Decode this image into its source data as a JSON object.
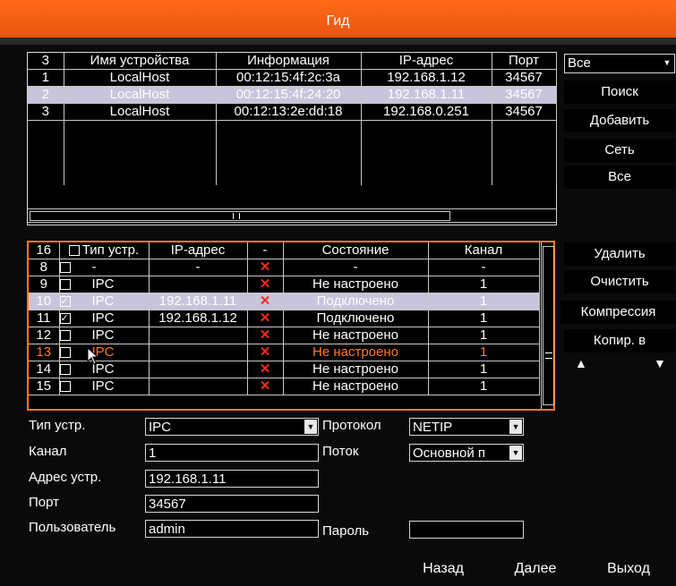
{
  "window": {
    "title": "Гид"
  },
  "search_table": {
    "headers": [
      "3",
      "Имя устройства",
      "Информация",
      "IP-адрес",
      "Порт"
    ],
    "rows": [
      {
        "num": "1",
        "name": "LocalHost",
        "info": "00:12:15:4f:2c:3a",
        "ip": "192.168.1.12",
        "port": "34567",
        "selected": false
      },
      {
        "num": "2",
        "name": "LocalHost",
        "info": "00:12:15:4f:24:20",
        "ip": "192.168.1.11",
        "port": "34567",
        "selected": true
      },
      {
        "num": "3",
        "name": "LocalHost",
        "info": "00:12:13:2e:dd:18",
        "ip": "192.168.0.251",
        "port": "34567",
        "selected": false
      }
    ]
  },
  "filter_select": {
    "value": "Все"
  },
  "right_buttons": {
    "search": "Поиск",
    "add": "Добавить",
    "network": "Сеть",
    "all": "Все"
  },
  "channel_table": {
    "headers": [
      "16",
      "Тип устр.",
      "IP-адрес",
      "-",
      "Состояние",
      "Канал"
    ],
    "rows": [
      {
        "num": "8",
        "checked": false,
        "type": "-",
        "ip": "-",
        "status": "-",
        "channel": "-",
        "style": ""
      },
      {
        "num": "9",
        "checked": false,
        "type": "IPC",
        "ip": "",
        "status": "Не настроено",
        "channel": "1",
        "style": ""
      },
      {
        "num": "10",
        "checked": true,
        "type": "IPC",
        "ip": "192.168.1.11",
        "status": "Подключено",
        "channel": "1",
        "style": "sel"
      },
      {
        "num": "11",
        "checked": true,
        "type": "IPC",
        "ip": "192.168.1.12",
        "status": "Подключено",
        "channel": "1",
        "style": ""
      },
      {
        "num": "12",
        "checked": false,
        "type": "IPC",
        "ip": "",
        "status": "Не настроено",
        "channel": "1",
        "style": ""
      },
      {
        "num": "13",
        "checked": false,
        "type": "IPC",
        "ip": "",
        "status": "Не настроено",
        "channel": "1",
        "style": "orange"
      },
      {
        "num": "14",
        "checked": false,
        "type": "IPC",
        "ip": "",
        "status": "Не настроено",
        "channel": "1",
        "style": ""
      },
      {
        "num": "15",
        "checked": false,
        "type": "IPC",
        "ip": "",
        "status": "Не настроено",
        "channel": "1",
        "style": ""
      }
    ]
  },
  "side_buttons": {
    "delete": "Удалить",
    "clear": "Очистить",
    "compression": "Компрессия",
    "copy_to": "Копир. в"
  },
  "form": {
    "device_type_label": "Тип устр.",
    "device_type_value": "IPC",
    "protocol_label": "Протокол",
    "protocol_value": "NETIP",
    "channel_label": "Канал",
    "channel_value": "1",
    "stream_label": "Поток",
    "stream_value": "Основной п",
    "address_label": "Адрес устр.",
    "address_value": "192.168.1.11",
    "port_label": "Порт",
    "port_value": "34567",
    "user_label": "Пользователь",
    "user_value": "admin",
    "password_label": "Пароль",
    "password_value": ""
  },
  "bottom_buttons": {
    "back": "Назад",
    "next": "Далее",
    "exit": "Выход"
  },
  "colors": {
    "accent": "#ff6a18",
    "selected_row": "#c8c4dc",
    "error_x": "#ff2a1a"
  }
}
